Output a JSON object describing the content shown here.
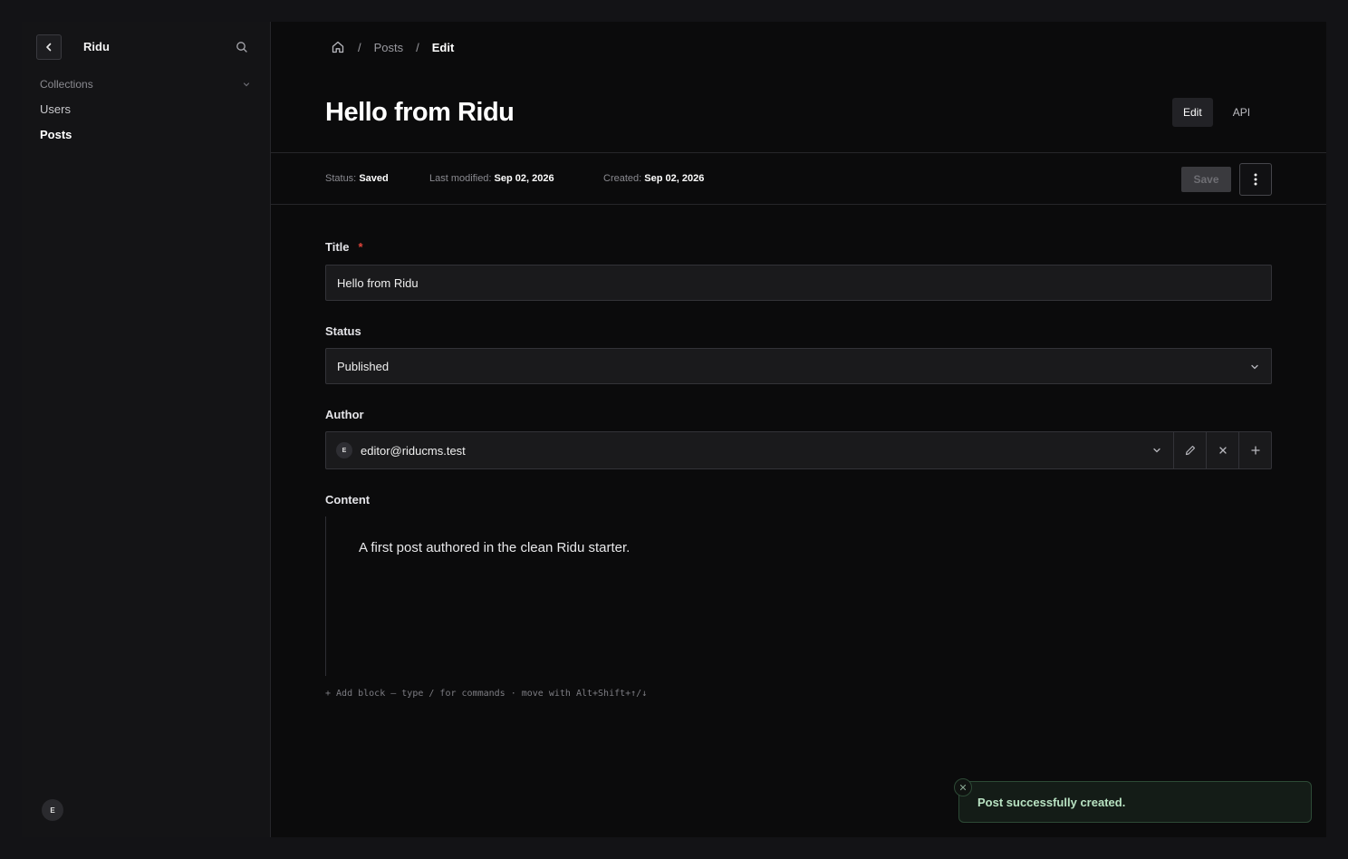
{
  "sidebar": {
    "brand": "Ridu",
    "collections_label": "Collections",
    "items": [
      {
        "label": "Users"
      },
      {
        "label": "Posts"
      }
    ],
    "user_initial": "E"
  },
  "breadcrumb": {
    "items": [
      "Posts",
      "Edit"
    ]
  },
  "header": {
    "title": "Hello from Ridu",
    "tabs": [
      {
        "label": "Edit",
        "active": true
      },
      {
        "label": "API",
        "active": false
      }
    ]
  },
  "meta": {
    "status_label": "Status:",
    "status_value": "Saved",
    "modified_label": "Last modified:",
    "modified_value": "Sep 02, 2026",
    "created_label": "Created:",
    "created_value": "Sep 02, 2026",
    "save_label": "Save"
  },
  "form": {
    "title_label": "Title",
    "required_mark": "*",
    "title_value": "Hello from Ridu",
    "status_label": "Status",
    "status_value": "Published",
    "author_label": "Author",
    "author_initial": "E",
    "author_value": "editor@riducms.test",
    "content_label": "Content",
    "content_text": "A first post authored in the clean Ridu starter.",
    "content_hint": "+ Add block — type / for commands · move with Alt+Shift+↑/↓"
  },
  "toast": {
    "message": "Post successfully created."
  },
  "colors": {
    "background": "#0b0b0c",
    "sidebar": "#141416",
    "required": "#e0443a",
    "toast_border": "#2d4a36",
    "toast_text": "#b8e2c2"
  }
}
